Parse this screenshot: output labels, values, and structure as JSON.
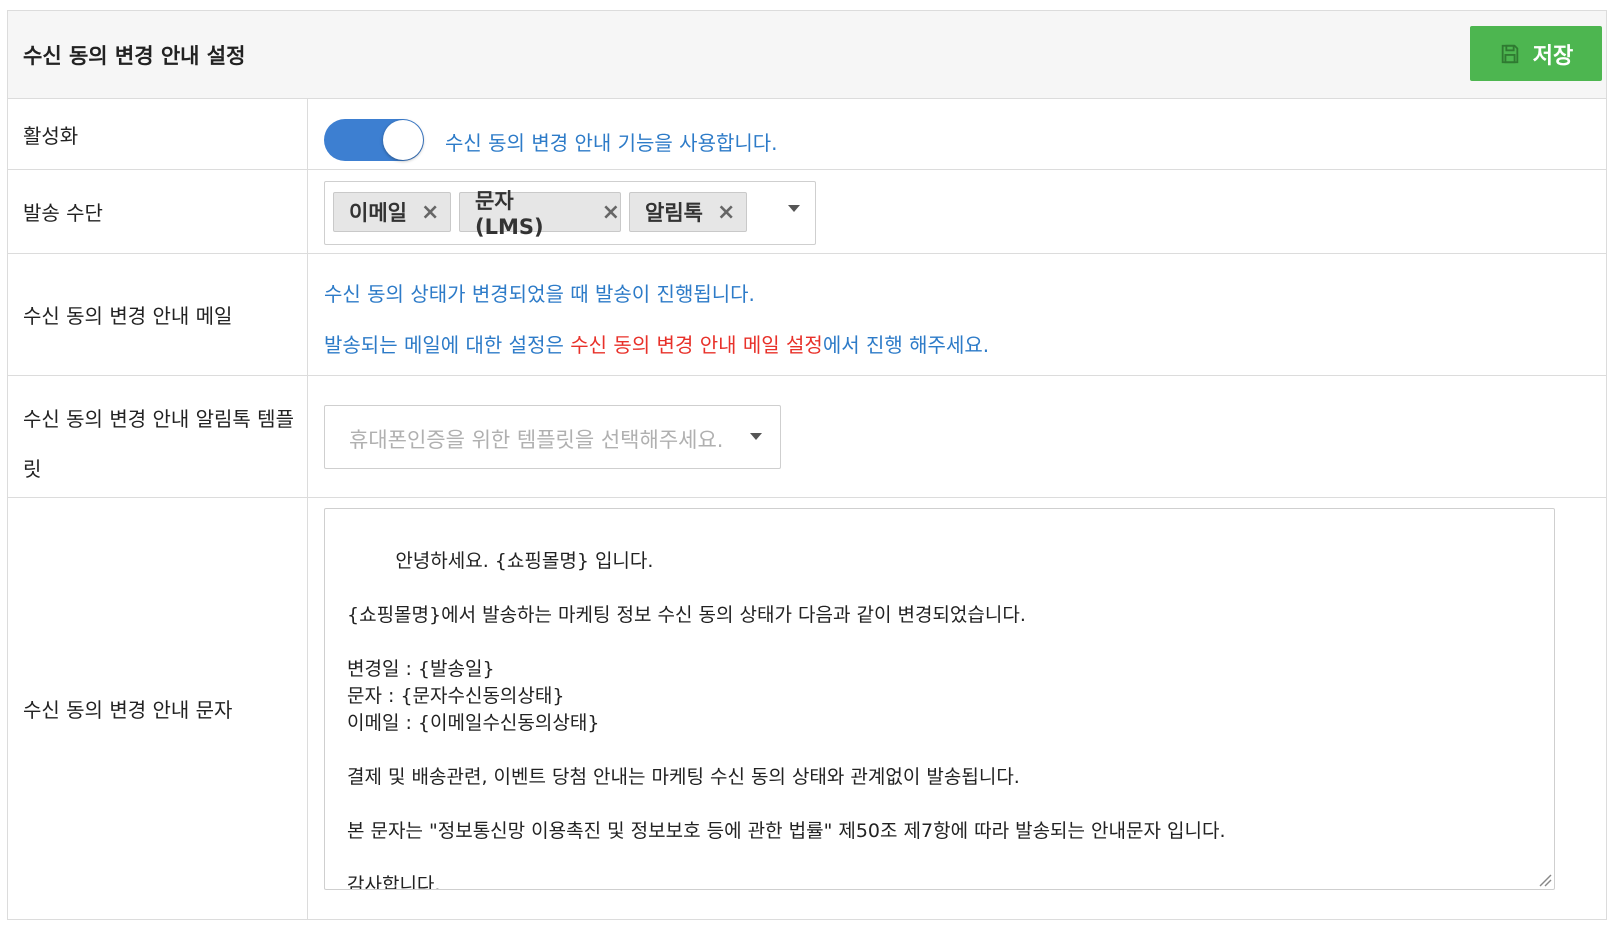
{
  "header": {
    "title": "수신 동의 변경 안내 설정",
    "save_label": "저장",
    "save_icon": "floppy-disk-icon",
    "save_color": "#4db650"
  },
  "rows": {
    "activation": {
      "label": "활성화",
      "toggle_on": true,
      "toggle_color": "#3d7fd1",
      "description": "수신 동의 변경 안내 기능을 사용합니다."
    },
    "send_method": {
      "label": "발송 수단",
      "tags": [
        "이메일",
        "문자 (LMS)",
        "알림톡"
      ],
      "remove_icon": "close-icon"
    },
    "email": {
      "label": "수신 동의 변경 안내 메일",
      "line1": "수신 동의 상태가 변경되었을 때 발송이 진행됩니다.",
      "line2_prefix": "발송되는 메일에 대한 설정은 ",
      "line2_link": "수신 동의 변경 안내 메일 설정",
      "line2_suffix": "에서 진행 해주세요."
    },
    "alimtalk_template": {
      "label": "수신 동의 변경 안내 알림톡 템플릿",
      "placeholder": "휴대폰인증을 위한 템플릿을 선택해주세요."
    },
    "sms": {
      "label": "수신 동의 변경 안내 문자",
      "message": "안녕하세요. {쇼핑몰명} 입니다.\n\n{쇼핑몰명}에서 발송하는 마케팅 정보 수신 동의 상태가 다음과 같이 변경되었습니다.\n\n변경일 : {발송일}\n문자 : {문자수신동의상태}\n이메일 : {이메일수신동의상태}\n\n결제 및 배송관련, 이벤트 당첨 안내는 마케팅 수신 동의 상태와 관계없이 발송됩니다.\n\n본 문자는 \"정보통신망 이용촉진 및 정보보호 등에 관한 법률\" 제50조 제7항에 따라 발송되는 안내문자 입니다.\n\n감사합니다."
    }
  }
}
